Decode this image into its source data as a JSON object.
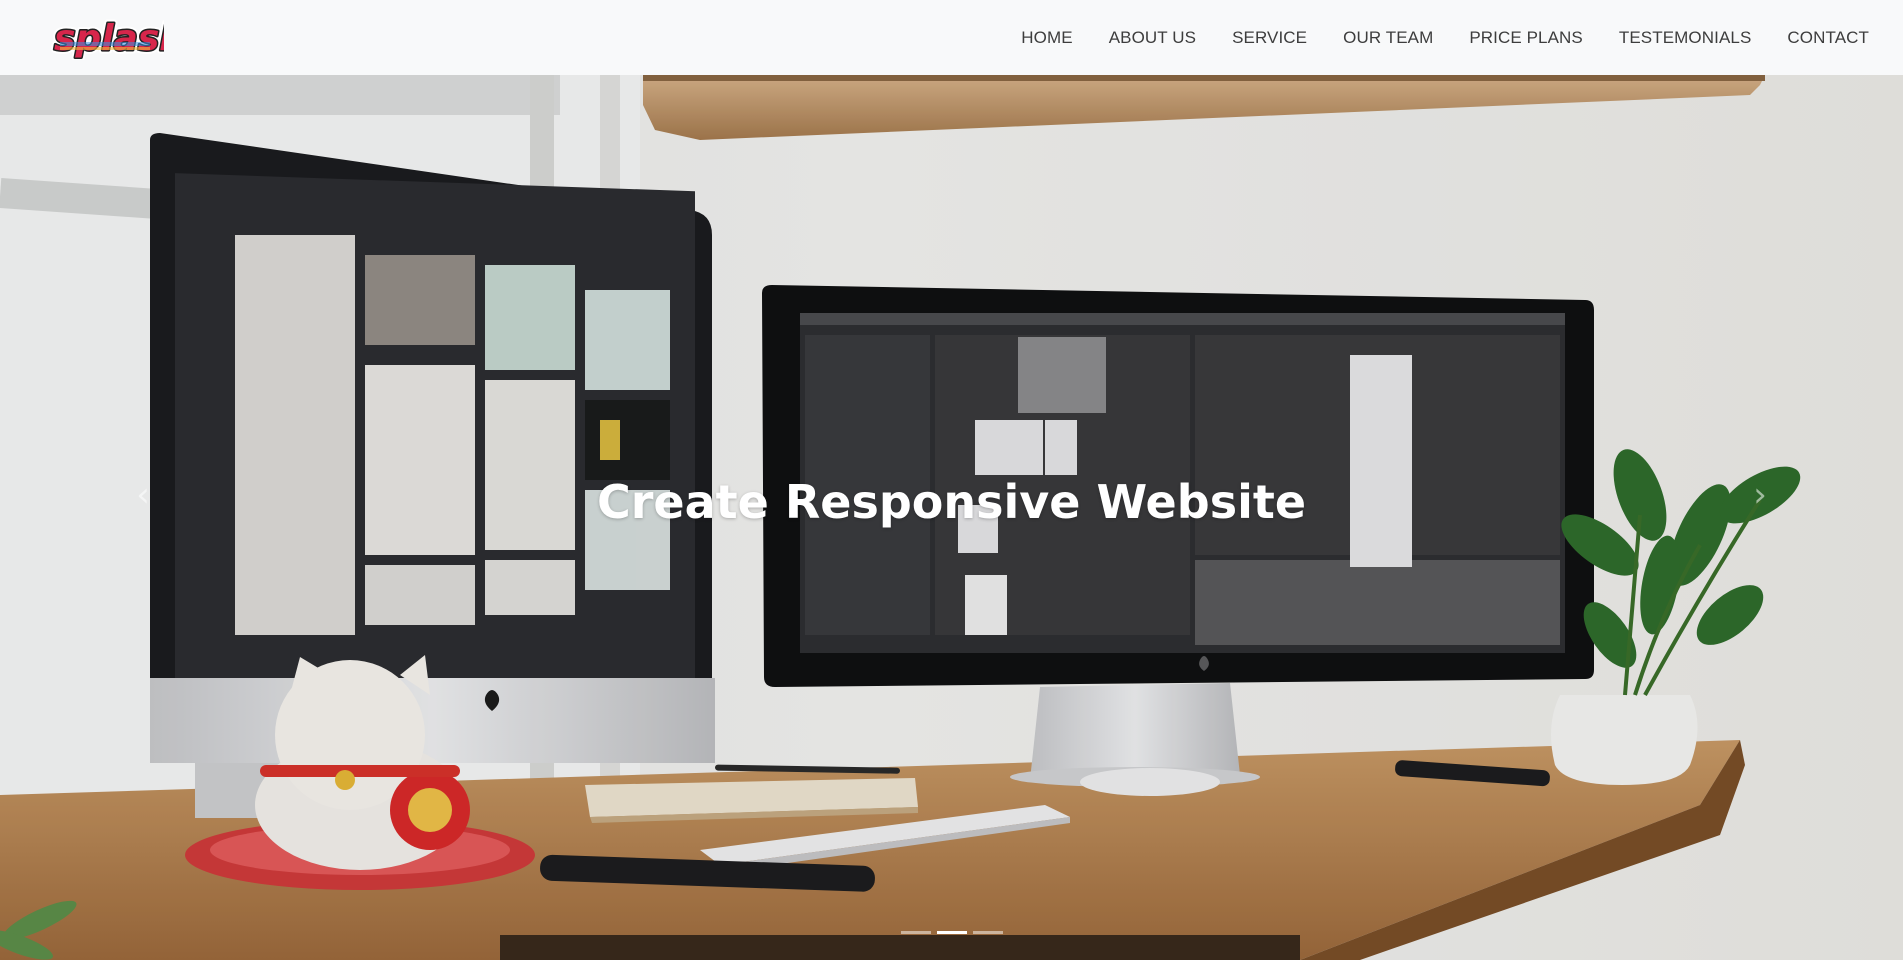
{
  "brand": {
    "logo_text": "splash"
  },
  "nav": {
    "items": [
      {
        "label": "HOME"
      },
      {
        "label": "ABOUT US"
      },
      {
        "label": "SERVICE"
      },
      {
        "label": "OUR TEAM"
      },
      {
        "label": "PRICE PLANS"
      },
      {
        "label": "TESTEMONIALS"
      },
      {
        "label": "CONTACT"
      }
    ]
  },
  "hero": {
    "title": "Create Responsive Website",
    "prev_icon": "chevron-left-icon",
    "next_icon": "chevron-right-icon",
    "slides_count": 3,
    "active_slide": 2
  },
  "colors": {
    "navbar_bg": "#f8f9fa",
    "nav_text": "#3d3d3d",
    "hero_title": "#ffffff"
  }
}
